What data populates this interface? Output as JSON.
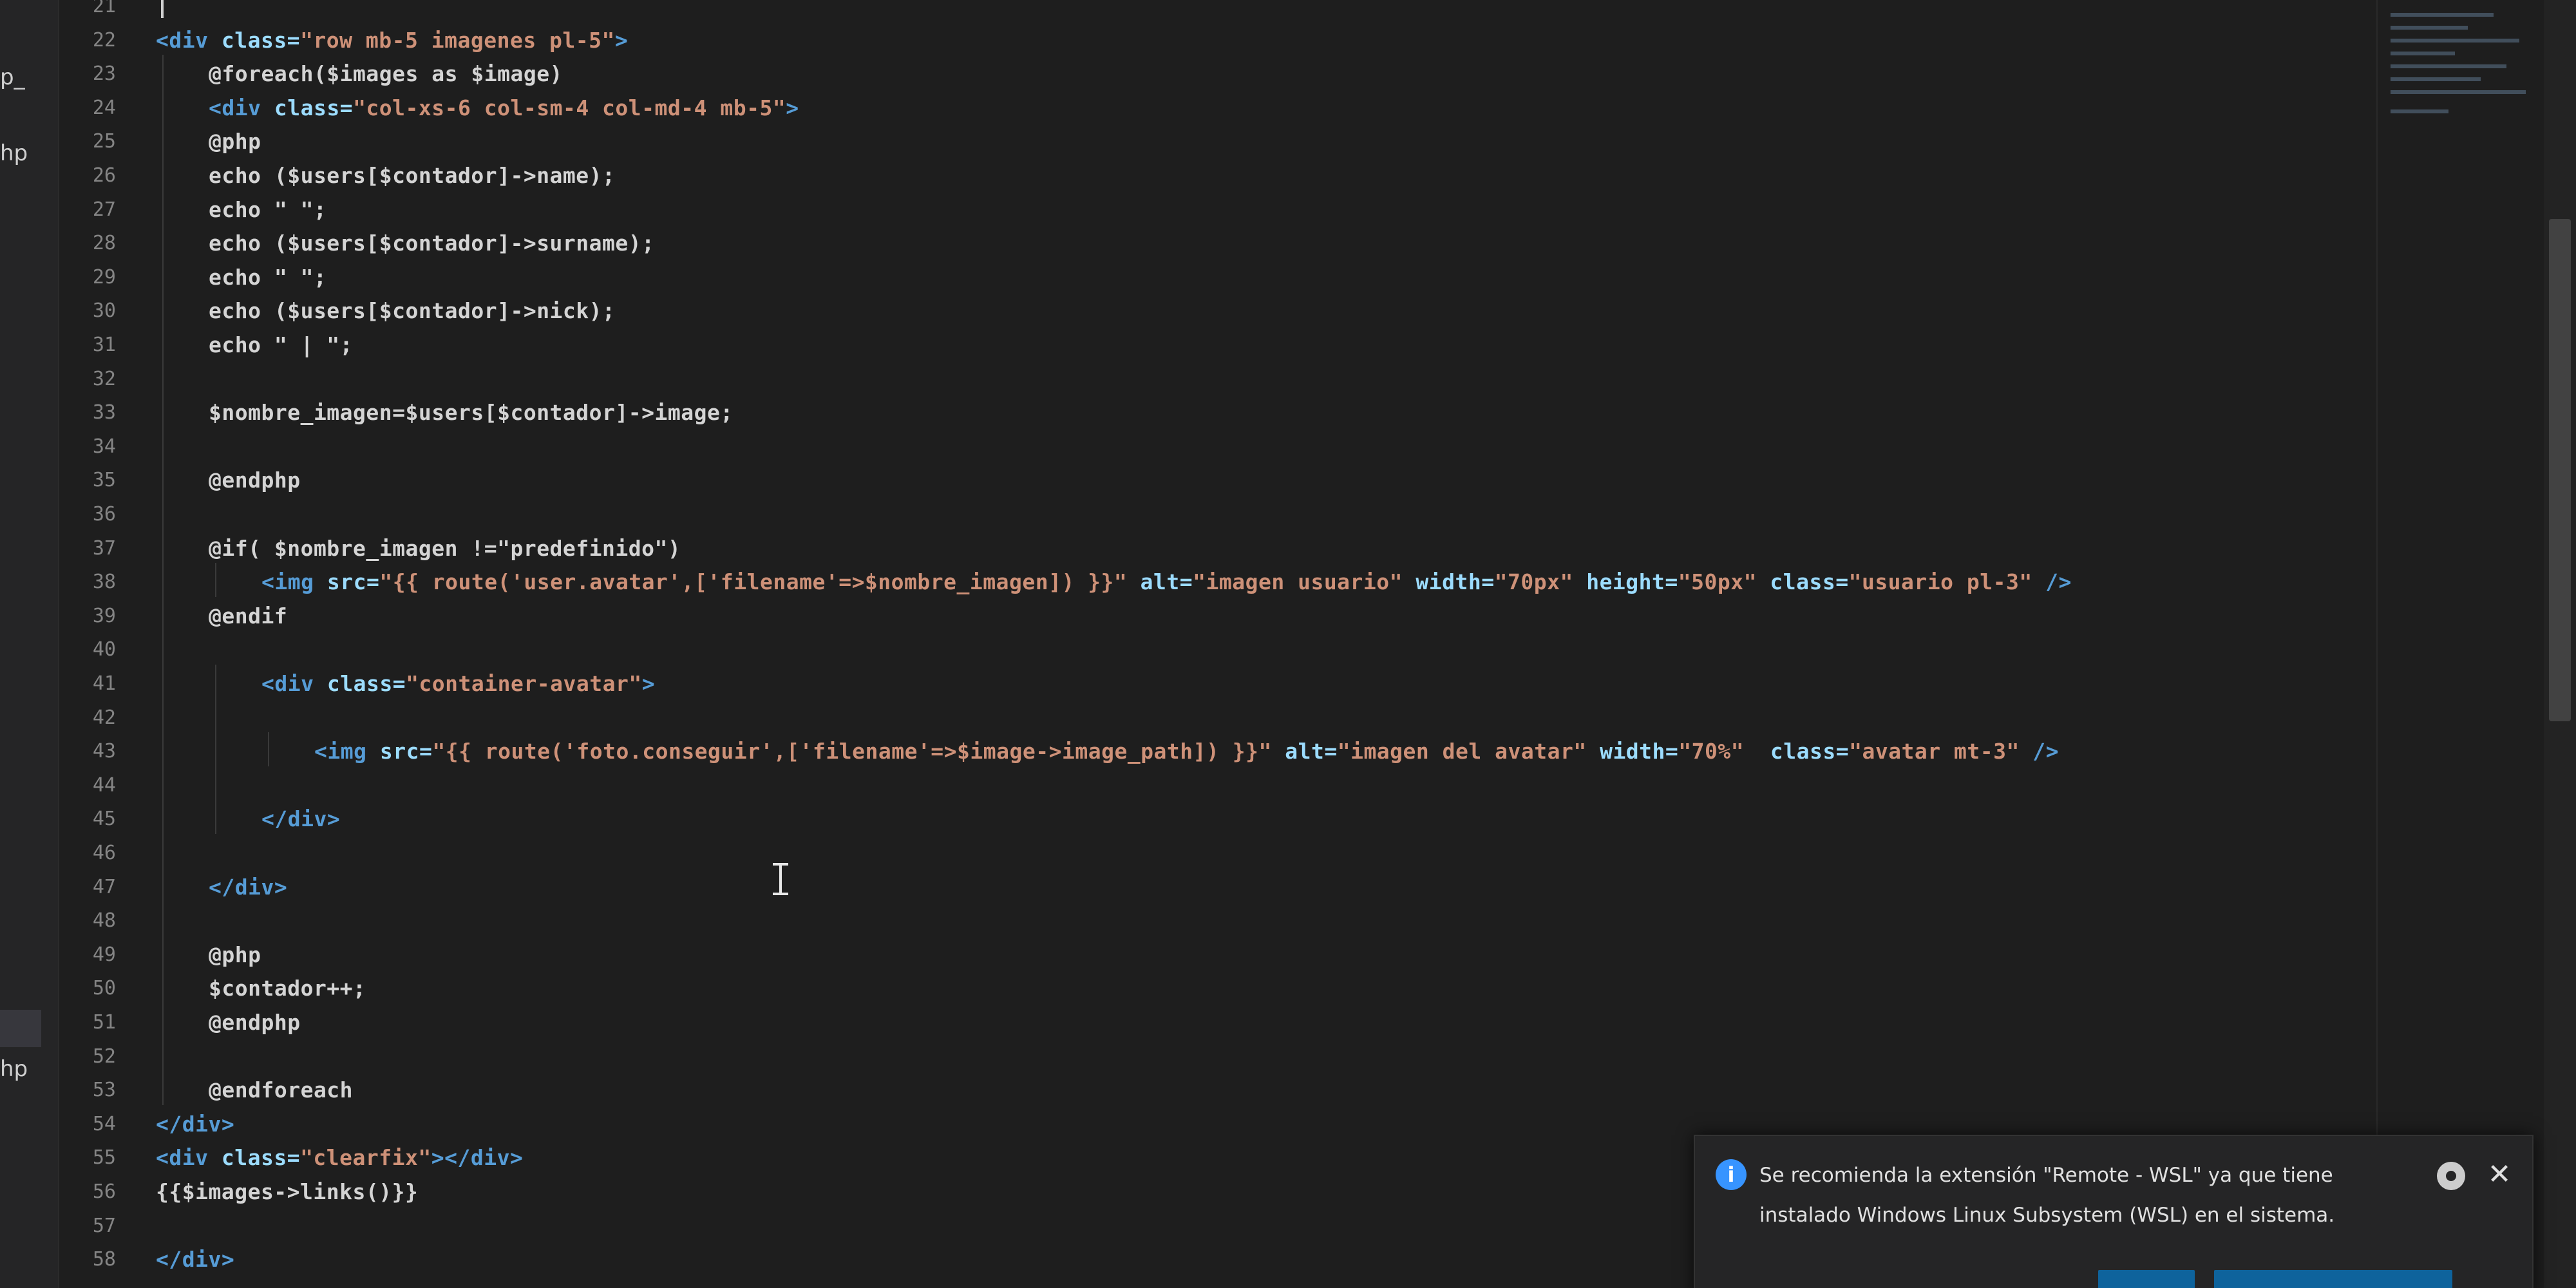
{
  "sidebar": {
    "fragments": [
      "p_",
      "hp",
      "hp"
    ]
  },
  "editor": {
    "lines": [
      {
        "num": "21",
        "indent": 0,
        "parts": [
          {
            "t": "",
            "c": "plain"
          }
        ]
      },
      {
        "num": "22",
        "indent": 0,
        "parts": [
          {
            "t": "<div ",
            "c": "tag"
          },
          {
            "t": "class=",
            "c": "attr"
          },
          {
            "t": "\"row mb-5 imagenes pl-5\"",
            "c": "str"
          },
          {
            "t": ">",
            "c": "tag"
          }
        ]
      },
      {
        "num": "23",
        "indent": 1,
        "parts": [
          {
            "t": "@foreach($images as $image)",
            "c": "plain"
          }
        ]
      },
      {
        "num": "24",
        "indent": 1,
        "parts": [
          {
            "t": "<div ",
            "c": "tag"
          },
          {
            "t": "class=",
            "c": "attr"
          },
          {
            "t": "\"col-xs-6 col-sm-4 col-md-4 mb-5\"",
            "c": "str"
          },
          {
            "t": ">",
            "c": "tag"
          }
        ]
      },
      {
        "num": "25",
        "indent": 1,
        "parts": [
          {
            "t": "@php",
            "c": "plain"
          }
        ]
      },
      {
        "num": "26",
        "indent": 1,
        "parts": [
          {
            "t": "echo ($users[$contador]->name);",
            "c": "plain"
          }
        ]
      },
      {
        "num": "27",
        "indent": 1,
        "parts": [
          {
            "t": "echo \" \";",
            "c": "plain"
          }
        ]
      },
      {
        "num": "28",
        "indent": 1,
        "parts": [
          {
            "t": "echo ($users[$contador]->surname);",
            "c": "plain"
          }
        ]
      },
      {
        "num": "29",
        "indent": 1,
        "parts": [
          {
            "t": "echo \" \";",
            "c": "plain"
          }
        ]
      },
      {
        "num": "30",
        "indent": 1,
        "parts": [
          {
            "t": "echo ($users[$contador]->nick);",
            "c": "plain"
          }
        ]
      },
      {
        "num": "31",
        "indent": 1,
        "parts": [
          {
            "t": "echo \" | \";",
            "c": "plain"
          }
        ]
      },
      {
        "num": "32",
        "indent": 1,
        "parts": [
          {
            "t": "",
            "c": "plain"
          }
        ]
      },
      {
        "num": "33",
        "indent": 1,
        "parts": [
          {
            "t": "$nombre_imagen=$users[$contador]->image;",
            "c": "plain"
          }
        ]
      },
      {
        "num": "34",
        "indent": 1,
        "parts": [
          {
            "t": "",
            "c": "plain"
          }
        ]
      },
      {
        "num": "35",
        "indent": 1,
        "parts": [
          {
            "t": "@endphp",
            "c": "plain"
          }
        ]
      },
      {
        "num": "36",
        "indent": 1,
        "parts": [
          {
            "t": "",
            "c": "plain"
          }
        ]
      },
      {
        "num": "37",
        "indent": 1,
        "parts": [
          {
            "t": "@if( $nombre_imagen !=\"predefinido\")",
            "c": "plain"
          }
        ]
      },
      {
        "num": "38",
        "indent": 2,
        "parts": [
          {
            "t": "<img ",
            "c": "tag"
          },
          {
            "t": "src=",
            "c": "attr"
          },
          {
            "t": "\"{{ route('user.avatar',['filename'=>$nombre_imagen]) }}\"",
            "c": "str"
          },
          {
            "t": " alt=",
            "c": "attr"
          },
          {
            "t": "\"imagen usuario\"",
            "c": "str"
          },
          {
            "t": " width=",
            "c": "attr"
          },
          {
            "t": "\"70px\"",
            "c": "str"
          },
          {
            "t": " height=",
            "c": "attr"
          },
          {
            "t": "\"50px\"",
            "c": "str"
          },
          {
            "t": " class=",
            "c": "attr"
          },
          {
            "t": "\"usuario pl-3\"",
            "c": "str"
          },
          {
            "t": " />",
            "c": "tag"
          }
        ]
      },
      {
        "num": "39",
        "indent": 1,
        "parts": [
          {
            "t": "@endif",
            "c": "plain"
          }
        ]
      },
      {
        "num": "40",
        "indent": 1,
        "parts": [
          {
            "t": "",
            "c": "plain"
          }
        ]
      },
      {
        "num": "41",
        "indent": 2,
        "parts": [
          {
            "t": "<div ",
            "c": "tag"
          },
          {
            "t": "class=",
            "c": "attr"
          },
          {
            "t": "\"container-avatar\"",
            "c": "str"
          },
          {
            "t": ">",
            "c": "tag"
          }
        ]
      },
      {
        "num": "42",
        "indent": 2,
        "parts": [
          {
            "t": "",
            "c": "plain"
          }
        ]
      },
      {
        "num": "43",
        "indent": 3,
        "parts": [
          {
            "t": "<img ",
            "c": "tag"
          },
          {
            "t": "src=",
            "c": "attr"
          },
          {
            "t": "\"{{ route('foto.conseguir',['filename'=>$image->image_path]) }}\"",
            "c": "str"
          },
          {
            "t": " alt=",
            "c": "attr"
          },
          {
            "t": "\"imagen del avatar\"",
            "c": "str"
          },
          {
            "t": " width=",
            "c": "attr"
          },
          {
            "t": "\"70%\"",
            "c": "str"
          },
          {
            "t": "  class=",
            "c": "attr"
          },
          {
            "t": "\"avatar mt-3\"",
            "c": "str"
          },
          {
            "t": " />",
            "c": "tag"
          }
        ]
      },
      {
        "num": "44",
        "indent": 2,
        "parts": [
          {
            "t": "",
            "c": "plain"
          }
        ]
      },
      {
        "num": "45",
        "indent": 2,
        "parts": [
          {
            "t": "</div>",
            "c": "tag"
          }
        ]
      },
      {
        "num": "46",
        "indent": 1,
        "parts": [
          {
            "t": "",
            "c": "plain"
          }
        ]
      },
      {
        "num": "47",
        "indent": 1,
        "parts": [
          {
            "t": "</div>",
            "c": "tag"
          }
        ]
      },
      {
        "num": "48",
        "indent": 1,
        "parts": [
          {
            "t": "",
            "c": "plain"
          }
        ]
      },
      {
        "num": "49",
        "indent": 1,
        "parts": [
          {
            "t": "@php",
            "c": "plain"
          }
        ]
      },
      {
        "num": "50",
        "indent": 1,
        "parts": [
          {
            "t": "$contador++;",
            "c": "plain"
          }
        ]
      },
      {
        "num": "51",
        "indent": 1,
        "parts": [
          {
            "t": "@endphp",
            "c": "plain"
          }
        ]
      },
      {
        "num": "52",
        "indent": 1,
        "parts": [
          {
            "t": "",
            "c": "plain"
          }
        ]
      },
      {
        "num": "53",
        "indent": 1,
        "parts": [
          {
            "t": "@endforeach",
            "c": "plain"
          }
        ]
      },
      {
        "num": "54",
        "indent": 0,
        "parts": [
          {
            "t": "</div>",
            "c": "tag"
          }
        ]
      },
      {
        "num": "55",
        "indent": 0,
        "parts": [
          {
            "t": "<div ",
            "c": "tag"
          },
          {
            "t": "class=",
            "c": "attr"
          },
          {
            "t": "\"clearfix\"",
            "c": "str"
          },
          {
            "t": "></div>",
            "c": "tag"
          }
        ]
      },
      {
        "num": "56",
        "indent": 0,
        "parts": [
          {
            "t": "{{$images->links()}}",
            "c": "plain"
          }
        ]
      },
      {
        "num": "57",
        "indent": 0,
        "parts": [
          {
            "t": "",
            "c": "plain"
          }
        ]
      },
      {
        "num": "58",
        "indent": 0,
        "parts": [
          {
            "t": "</div>",
            "c": "tag"
          }
        ]
      }
    ]
  },
  "notification": {
    "icon": "info-icon",
    "line1": "Se recomienda la extensión \"Remote - WSL\" ya que tiene",
    "line2": "instalado Windows Linux Subsystem (WSL) en el sistema."
  },
  "colors": {
    "background": "#1e1e1e",
    "tag": "#569cd6",
    "attribute": "#9cdcfe",
    "string": "#ce9178",
    "plain": "#d4d4d4",
    "line_number": "#858585",
    "accent": "#3794ff"
  }
}
